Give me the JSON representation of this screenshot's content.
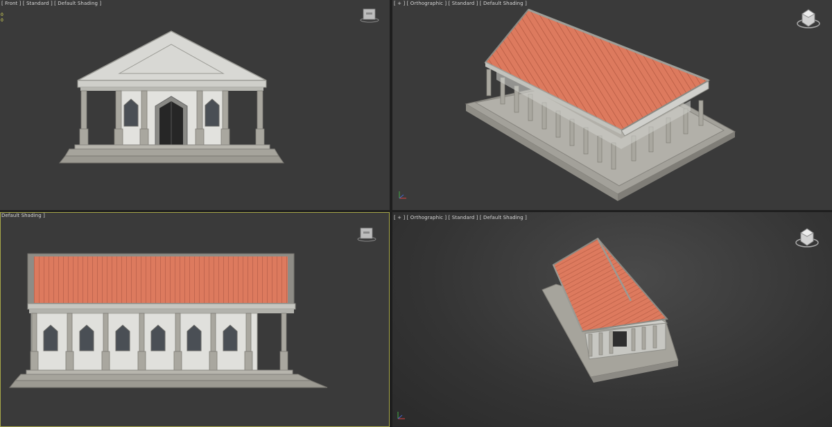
{
  "viewports": {
    "top_left": {
      "label": "[ Front ] [ Standard ] [ Default Shading ]",
      "stats": [
        "0",
        "0"
      ]
    },
    "top_right": {
      "label": "[ + ] [ Orthographic ] [ Standard ] [ Default Shading ]"
    },
    "bottom_left": {
      "label": "Default Shading ]"
    },
    "bottom_right": {
      "label": "[ + ] [ Orthographic ] [ Standard ] [ Default Shading ]"
    }
  },
  "colors": {
    "viewport_bg": "#3a3a3a",
    "active_border": "#a8a84a",
    "roof_tile": "#d9755a",
    "marble": "#dcdcd8",
    "stone": "#a8a69e",
    "window_glass": "#444a50"
  },
  "icons": [
    "view-cube-icon",
    "axis-tripod-icon"
  ]
}
